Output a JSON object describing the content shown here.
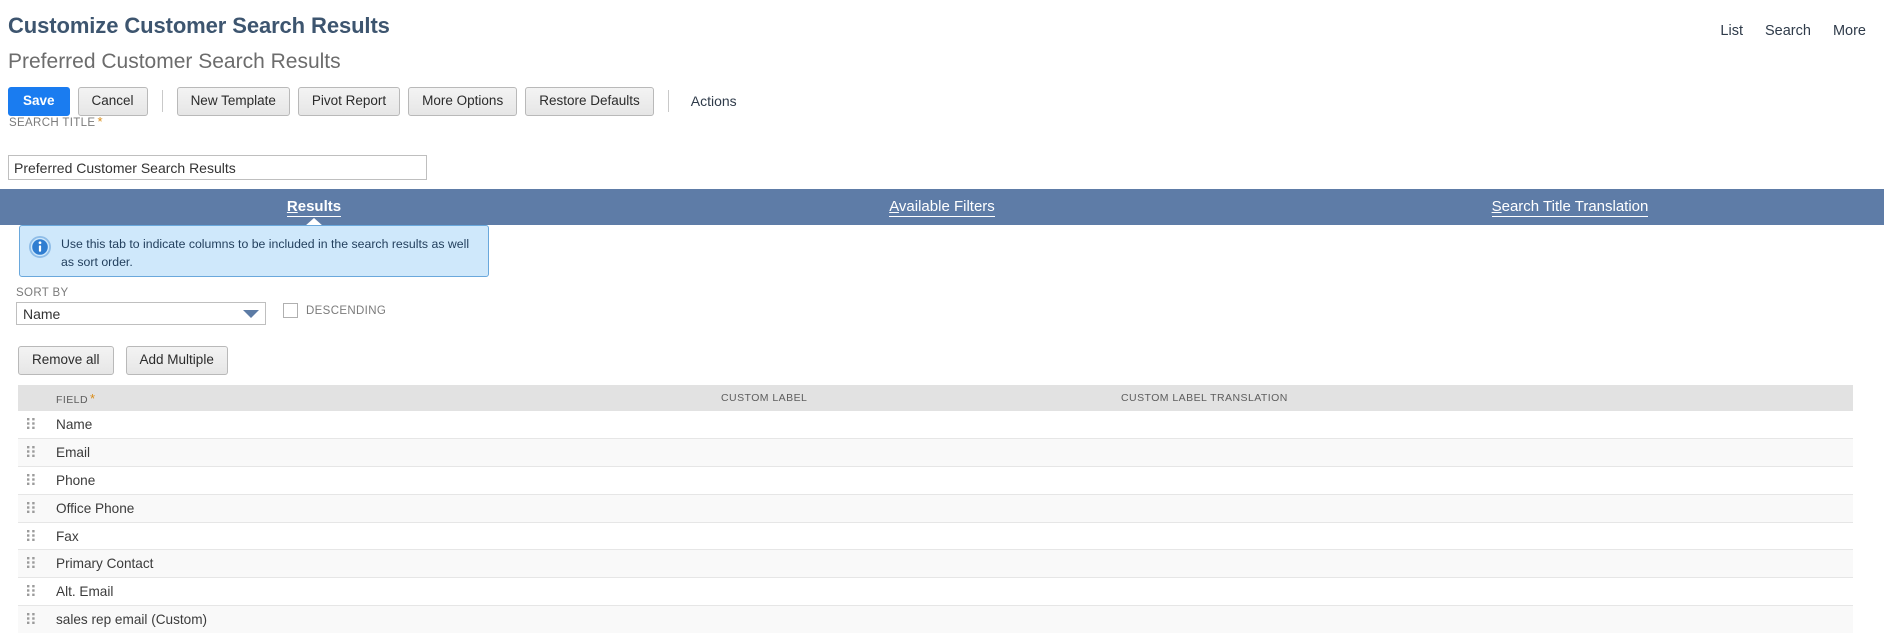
{
  "topnav": {
    "items": [
      {
        "label": "List",
        "name": "nav-list"
      },
      {
        "label": "Search",
        "name": "nav-search"
      },
      {
        "label": "More",
        "name": "nav-more"
      }
    ]
  },
  "header": {
    "title": "Customize Customer Search Results",
    "subtitle": "Preferred Customer Search Results"
  },
  "toolbar": {
    "save_label": "Save",
    "cancel_label": "Cancel",
    "new_template_label": "New Template",
    "pivot_report_label": "Pivot Report",
    "more_options_label": "More Options",
    "restore_defaults_label": "Restore Defaults",
    "actions_label": "Actions"
  },
  "search_title": {
    "label": "SEARCH TITLE",
    "required_marker": "*",
    "value": "Preferred Customer Search Results"
  },
  "tabs": [
    {
      "label": "Results",
      "accesskey": "R",
      "rest": "esults",
      "active": true
    },
    {
      "label": "Available Filters",
      "accesskey": "A",
      "rest": "vailable Filters",
      "active": false
    },
    {
      "label": "Search Title Translation",
      "accesskey": "S",
      "rest": "earch Title Translation",
      "active": false
    }
  ],
  "banner": {
    "icon": "info-circle-icon",
    "text": "Use this tab to indicate columns to be included in the search results as well as sort order."
  },
  "sort_by": {
    "label": "SORT BY",
    "value": "Name",
    "caret_icon": "chevron-down-icon",
    "descending_label": "DESCENDING",
    "descending_checked": false
  },
  "row_actions": {
    "remove_all_label": "Remove all",
    "add_multiple_label": "Add Multiple"
  },
  "table": {
    "columns": [
      {
        "label": "FIELD",
        "required_marker": "*"
      },
      {
        "label": "CUSTOM LABEL",
        "required_marker": ""
      },
      {
        "label": "CUSTOM LABEL TRANSLATION",
        "required_marker": ""
      }
    ],
    "rows": [
      {
        "handle": "drag-handle-icon",
        "field": "Name",
        "custom_label": "",
        "custom_label_translation": ""
      },
      {
        "handle": "drag-handle-icon",
        "field": "Email",
        "custom_label": "",
        "custom_label_translation": ""
      },
      {
        "handle": "drag-handle-icon",
        "field": "Phone",
        "custom_label": "",
        "custom_label_translation": ""
      },
      {
        "handle": "drag-handle-icon",
        "field": "Office Phone",
        "custom_label": "",
        "custom_label_translation": ""
      },
      {
        "handle": "drag-handle-icon",
        "field": "Fax",
        "custom_label": "",
        "custom_label_translation": ""
      },
      {
        "handle": "drag-handle-icon",
        "field": "Primary Contact",
        "custom_label": "",
        "custom_label_translation": ""
      },
      {
        "handle": "drag-handle-icon",
        "field": "Alt. Email",
        "custom_label": "",
        "custom_label_translation": ""
      },
      {
        "handle": "drag-handle-icon",
        "field": "sales rep email (Custom)",
        "custom_label": "",
        "custom_label_translation": ""
      }
    ]
  },
  "colors": {
    "tab_bar": "#5e7ca7",
    "primary_button": "#1a7cf0",
    "banner_bg": "#cfe8fb",
    "banner_border": "#6aa8dc",
    "title_text": "#3d556f",
    "required_marker": "#d98c18",
    "table_header_bg": "#e2e2e2"
  }
}
